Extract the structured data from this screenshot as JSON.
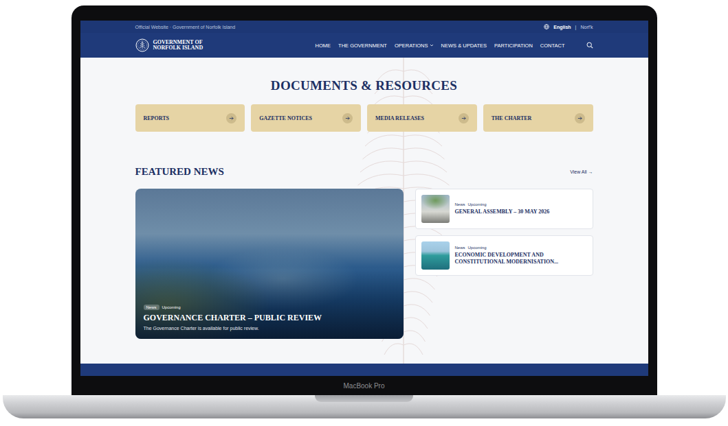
{
  "device": {
    "label": "MacBook Pro"
  },
  "topbar": {
    "official": "Official Website · Government of Norfolk Island",
    "separator": "|",
    "languages": [
      {
        "label": "English",
        "selected": true
      },
      {
        "label": "Norf'k",
        "selected": false
      }
    ]
  },
  "header": {
    "logo_line1": "GOVERNMENT OF",
    "logo_line2": "NORFOLK ISLAND",
    "nav": [
      {
        "label": "HOME",
        "dropdown": false
      },
      {
        "label": "THE GOVERNMENT",
        "dropdown": false
      },
      {
        "label": "OPERATIONS",
        "dropdown": true
      },
      {
        "label": "NEWS & UPDATES",
        "dropdown": false
      },
      {
        "label": "PARTICIPATION",
        "dropdown": false
      },
      {
        "label": "CONTACT",
        "dropdown": false
      }
    ]
  },
  "documents": {
    "title": "DOCUMENTS & RESOURCES",
    "cards": [
      "REPORTS",
      "GAZETTE NOTICES",
      "MEDIA RELEASES",
      "THE CHARTER"
    ]
  },
  "featured": {
    "title": "FEATURED NEWS",
    "view_all": "View All →",
    "main": {
      "tags": [
        "News",
        "Upcoming"
      ],
      "title": "GOVERNANCE CHARTER – PUBLIC REVIEW",
      "description": "The Governance Charter is available for public review."
    },
    "items": [
      {
        "tags": [
          "News",
          "Upcoming"
        ],
        "title": "GENERAL ASSEMBLY – 30 MAY 2026"
      },
      {
        "tags": [
          "News",
          "Upcoming"
        ],
        "title": "ECONOMIC DEVELOPMENT AND CONSTITUTIONAL MODERNISATION..."
      }
    ]
  }
}
